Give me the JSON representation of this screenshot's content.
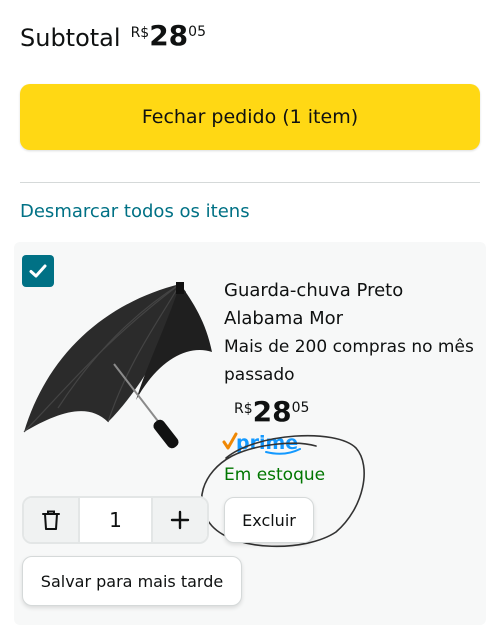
{
  "subtotal": {
    "label": "Subtotal",
    "currency": "R$",
    "whole": "28",
    "fraction": "05"
  },
  "checkout_button": {
    "label": "Fechar pedido (1 item)"
  },
  "deselect_link": {
    "label": "Desmarcar todos os itens"
  },
  "cart_item": {
    "selected": true,
    "image_icon": "umbrella-image",
    "title": "Guarda-chuva Preto Alabama Mor",
    "purchase_note": "Mais de 200 compras no mês passado",
    "price": {
      "currency": "R$",
      "whole": "28",
      "fraction": "05"
    },
    "prime_badge": "prime",
    "stock_status": "Em estoque",
    "quantity": "1",
    "delete_label": "Excluir",
    "save_later_label": "Salvar para mais tarde"
  },
  "colors": {
    "accent_yellow": "#ffd814",
    "link_teal": "#007185",
    "stock_green": "#007600",
    "prime_blue": "#1399ff",
    "prime_orange": "#f08804"
  }
}
